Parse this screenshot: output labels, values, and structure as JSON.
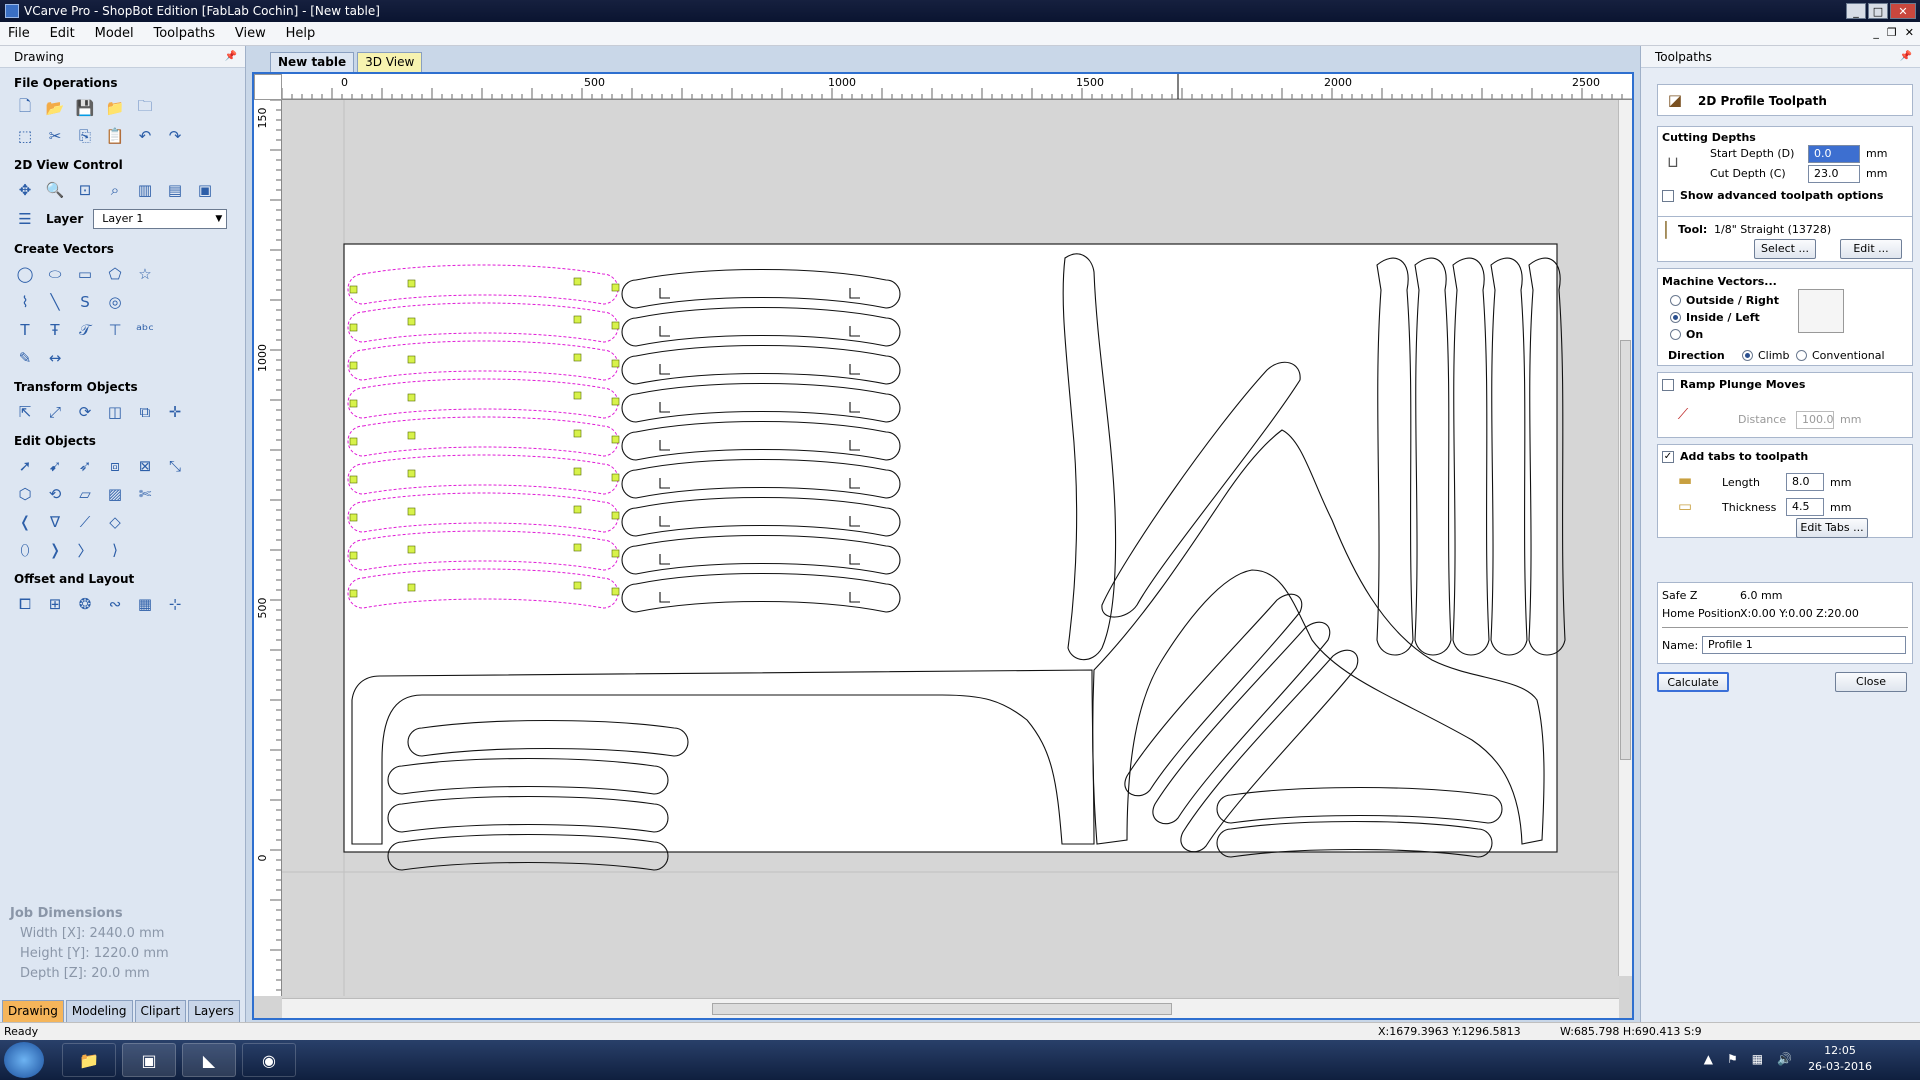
{
  "window": {
    "title": "VCarve Pro - ShopBot Edition [FabLab Cochin] - [New table]"
  },
  "menu": [
    "File",
    "Edit",
    "Model",
    "Toolpaths",
    "View",
    "Help"
  ],
  "left_panel": {
    "title": "Drawing",
    "sections": {
      "file_ops": "File Operations",
      "view_ctrl": "2D View Control",
      "create_vectors": "Create Vectors",
      "transform": "Transform Objects",
      "edit_objects": "Edit Objects",
      "offset_layout": "Offset and Layout"
    },
    "layer_label": "Layer",
    "layer_value": "Layer 1",
    "job_dimensions": {
      "title": "Job Dimensions",
      "width": "Width  [X]: 2440.0 mm",
      "height": "Height [Y]: 1220.0 mm",
      "depth": "Depth  [Z]: 20.0 mm"
    },
    "tabs": [
      "Drawing",
      "Modeling",
      "Clipart",
      "Layers"
    ]
  },
  "view_tabs": [
    "New table",
    "3D View"
  ],
  "ruler": {
    "h_labels": [
      "0",
      "500",
      "1000",
      "1500",
      "2000",
      "2500"
    ],
    "v_labels": [
      "150",
      "1000",
      "500",
      "0"
    ]
  },
  "right_panel": {
    "title": "Toolpaths",
    "toolpath_name": "2D Profile Toolpath",
    "cutting_depths": {
      "title": "Cutting Depths",
      "start_label": "Start Depth (D)",
      "start_value": "0.0",
      "cut_label": "Cut Depth (C)",
      "cut_value": "23.0",
      "unit": "mm"
    },
    "advanced_label": "Show advanced toolpath options",
    "tool": {
      "label": "Tool:",
      "value": "1/8\" Straight (13728)",
      "select": "Select ...",
      "edit": "Edit ..."
    },
    "machine_vectors": {
      "title": "Machine Vectors...",
      "outside": "Outside / Right",
      "inside": "Inside / Left",
      "on": "On",
      "direction": "Direction",
      "climb": "Climb",
      "conventional": "Conventional"
    },
    "ramp": {
      "label": "Ramp Plunge Moves",
      "distance_label": "Distance",
      "distance_value": "100.0",
      "unit": "mm"
    },
    "tabs": {
      "label": "Add tabs to toolpath",
      "length_label": "Length",
      "length_value": "8.0",
      "thickness_label": "Thickness",
      "thickness_value": "4.5",
      "unit": "mm",
      "edit": "Edit Tabs ..."
    },
    "safe_z": {
      "label": "Safe Z",
      "value": "6.0 mm"
    },
    "home": {
      "label": "Home Position",
      "value": "X:0.00 Y:0.00 Z:20.00"
    },
    "name": {
      "label": "Name:",
      "value": "Profile 1"
    },
    "calculate": "Calculate",
    "close": "Close"
  },
  "status": {
    "ready": "Ready",
    "coords": "X:1679.3963 Y:1296.5813",
    "dims": "W:685.798   H:690.413  S:9"
  },
  "taskbar": {
    "time": "12:05",
    "date": "26-03-2016"
  },
  "colors": {
    "accent": "#2e6fcf",
    "toolpath": "#e01bd6",
    "active_tab": "#f5b55a"
  }
}
